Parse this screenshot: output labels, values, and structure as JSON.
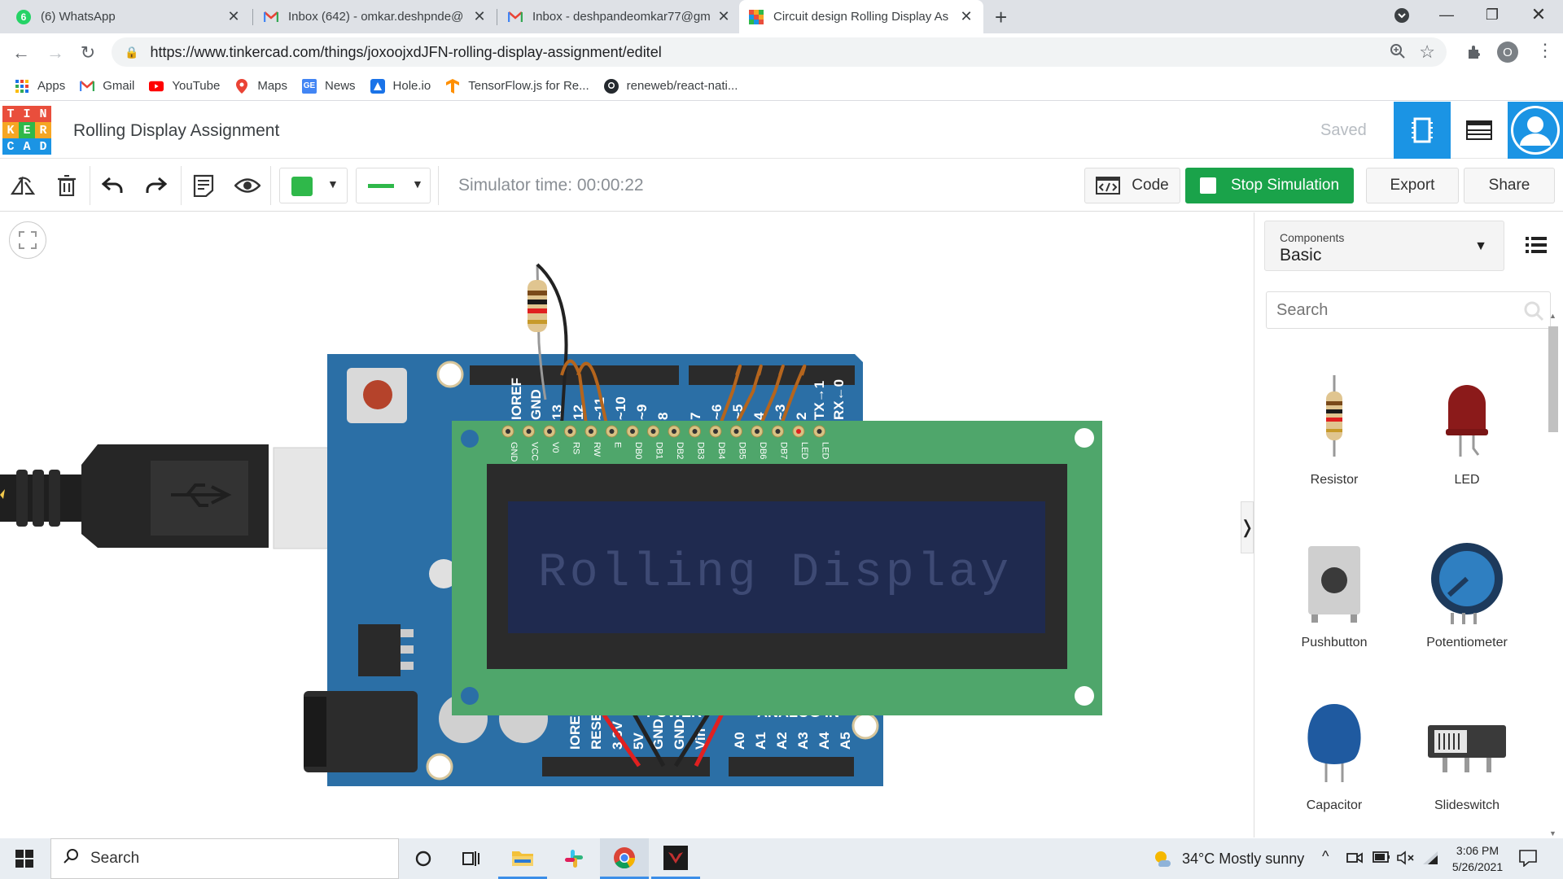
{
  "browser": {
    "tabs": [
      {
        "title": "(6) WhatsApp",
        "icon": "whatsapp-icon"
      },
      {
        "title": "Inbox (642) - omkar.deshpnde@",
        "icon": "gmail-icon"
      },
      {
        "title": "Inbox - deshpandeomkar77@gm",
        "icon": "gmail-icon"
      },
      {
        "title": "Circuit design Rolling Display As",
        "icon": "tinkercad-icon",
        "active": true
      }
    ],
    "new_tab": "+",
    "url": "https://www.tinkercad.com/things/joxoojxdJFN-rolling-display-assignment/editel",
    "profile_letter": "O",
    "bookmarks": [
      {
        "label": "Apps",
        "icon": "apps-grid-icon"
      },
      {
        "label": "Gmail",
        "icon": "gmail-icon"
      },
      {
        "label": "YouTube",
        "icon": "youtube-icon"
      },
      {
        "label": "Maps",
        "icon": "maps-icon"
      },
      {
        "label": "News",
        "icon": "news-icon"
      },
      {
        "label": "Hole.io",
        "icon": "holeio-icon"
      },
      {
        "label": "TensorFlow.js for Re...",
        "icon": "tensorflow-icon"
      },
      {
        "label": "reneweb/react-nati...",
        "icon": "github-icon"
      }
    ]
  },
  "app": {
    "logo_letters": [
      "T",
      "I",
      "N",
      "K",
      "E",
      "R",
      "C",
      "A",
      "D"
    ],
    "project_title": "Rolling Display Assignment",
    "saved_label": "Saved"
  },
  "toolbar": {
    "sim_time": "Simulator time: 00:00:22",
    "code_label": "Code",
    "stop_label": "Stop Simulation",
    "export_label": "Export",
    "share_label": "Share",
    "fill_color": "#2fb84a"
  },
  "circuit": {
    "lcd_text": "Rolling Display",
    "lcd_pins": [
      "GND",
      "VCC",
      "V0",
      "RS",
      "RW",
      "E",
      "DB0",
      "DB1",
      "DB2",
      "DB3",
      "DB4",
      "DB5",
      "DB6",
      "DB7",
      "LED",
      "LED"
    ],
    "header_labels_top": [
      "IOREF",
      "GND",
      "13",
      "12",
      "~11",
      "~10",
      "~9",
      "8",
      "7",
      "~6",
      "~5",
      "4",
      "~3",
      "2",
      "TX→1",
      "RX←0"
    ],
    "header_labels_bottom": [
      "IOREF",
      "RESET",
      "3.3V",
      "5V",
      "GND",
      "GND",
      "Vin",
      "A0",
      "A1",
      "A2",
      "A3",
      "A4",
      "A5"
    ],
    "power_label": "POWER",
    "analog_label": "ANALOG IN"
  },
  "panel": {
    "components_label": "Components",
    "components_value": "Basic",
    "search_placeholder": "Search",
    "items": [
      {
        "name": "Resistor"
      },
      {
        "name": "LED"
      },
      {
        "name": "Pushbutton"
      },
      {
        "name": "Potentiometer"
      },
      {
        "name": "Capacitor"
      },
      {
        "name": "Slideswitch"
      }
    ]
  },
  "taskbar": {
    "search_label": "Search",
    "weather": "34°C  Mostly sunny",
    "time": "3:06 PM",
    "date": "5/26/2021"
  }
}
